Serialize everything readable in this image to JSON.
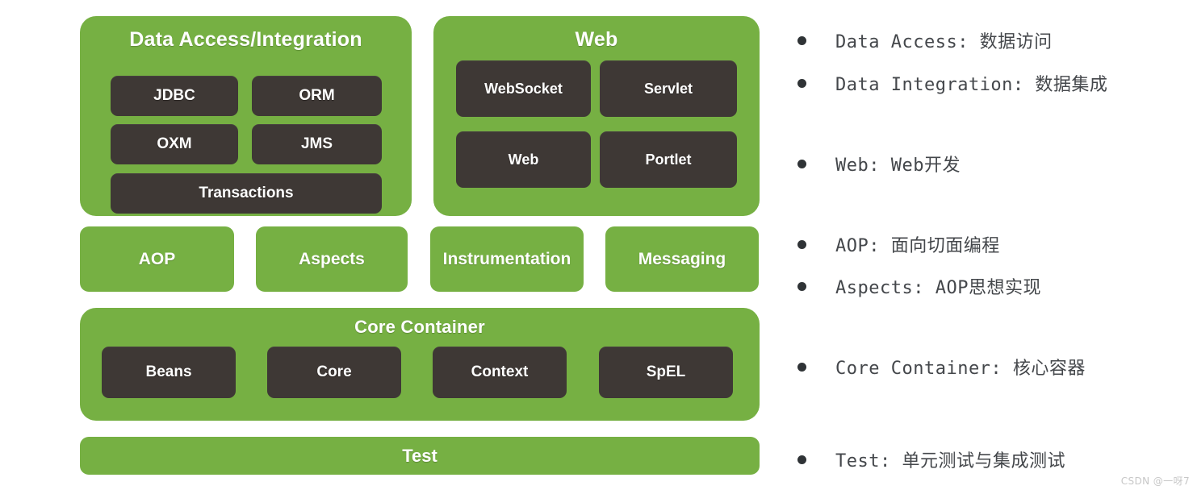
{
  "colors": {
    "green": "#76b043",
    "dark_chip": "#3e3835",
    "text_on_green": "#ffffff",
    "note_text": "#44474b",
    "bullet": "#2f3336",
    "background": "#ffffff",
    "watermark": "#c7c7c7"
  },
  "diagram": {
    "panels": [
      {
        "id": "data-access",
        "title": "Data Access/Integration",
        "chips": [
          "JDBC",
          "ORM",
          "OXM",
          "JMS",
          "Transactions"
        ]
      },
      {
        "id": "web",
        "title": "Web",
        "chips": [
          "WebSocket",
          "Servlet",
          "Web",
          "Portlet"
        ]
      },
      {
        "id": "core-container",
        "title": "Core Container",
        "chips": [
          "Beans",
          "Core",
          "Context",
          "SpEL"
        ]
      }
    ],
    "middle_row": [
      "AOP",
      "Aspects",
      "Instrumentation",
      "Messaging"
    ],
    "test_bar": "Test"
  },
  "notes": {
    "bullet_icon": "bullet-dot-icon",
    "items": [
      "Data Access: 数据访问",
      "Data Integration: 数据集成",
      "Web: Web开发",
      "AOP: 面向切面编程",
      "Aspects: AOP思想实现",
      "Core Container: 核心容器",
      "Test: 单元测试与集成测试"
    ]
  },
  "watermark": "CSDN @一呀7"
}
